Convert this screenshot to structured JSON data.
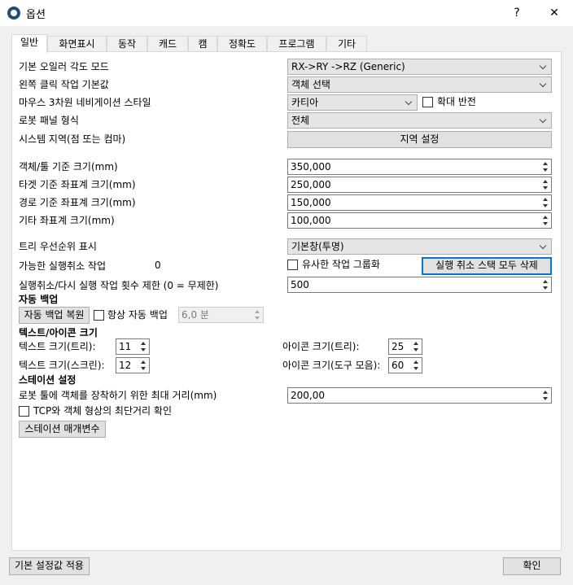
{
  "window": {
    "title": "옵션",
    "help": "?",
    "close": "✕"
  },
  "tabs": [
    "일반",
    "화면표시",
    "동작",
    "캐드",
    "캠",
    "정확도",
    "프로그램",
    "기타"
  ],
  "general": {
    "euler_label": "기본 오일러 각도 모드",
    "euler_value": "RX->RY ->RZ  (Generic)",
    "left_click_label": "왼쪽 클릭 작업 기본값",
    "left_click_value": "객체 선택",
    "mouse3d_label": "마우스 3차원 네비게이션 스타일",
    "mouse3d_value": "카티아",
    "zoom_invert_label": "확대 반전",
    "robot_panel_label": "로봇 패널 형식",
    "robot_panel_value": "전체",
    "region_label": "시스템 지역(점 또는 컴마)",
    "region_button": "지역 설정",
    "object_size_label": "객체/툴 기준 크기(mm)",
    "object_size_value": "350,000",
    "target_size_label": "타겟 기준 좌표계 크기(mm)",
    "target_size_value": "250,000",
    "path_size_label": "경로 기준 좌표계 크기(mm)",
    "path_size_value": "150,000",
    "other_size_label": "기타 좌표계 크기(mm)",
    "other_size_value": "100,000",
    "tree_priority_label": "트리 우선순위 표시",
    "tree_priority_value": "기본창(투명)",
    "undo_available_label": "가능한 실행취소 작업",
    "undo_available_value": "0",
    "group_similar_label": "유사한 작업 그룹화",
    "clear_undo_button": "실행 취소 스택 모두 삭제",
    "undo_limit_label": "실행취소/다시 실행 작업 횟수 제한 (0 = 무제한)",
    "undo_limit_value": "500"
  },
  "autobackup": {
    "heading": "자동 백업",
    "restore_button": "자동 백업 복원",
    "always_label": "항상 자동 백업",
    "interval_value": "6,0 분"
  },
  "textsize": {
    "heading": "텍스트/아이콘 크기",
    "text_tree_label": "텍스트 크기(트리):",
    "text_tree_value": "11",
    "text_screen_label": "텍스트 크기(스크린):",
    "text_screen_value": "12",
    "icon_tree_label": "아이콘 크기(트리):",
    "icon_tree_value": "25",
    "icon_toolbar_label": "아이콘 크기(도구 모음):",
    "icon_toolbar_value": "60"
  },
  "station": {
    "heading": "스테이션 설정",
    "max_dist_label": "로봇 툴에 객체를 장착하기 위한 최대 거리(mm)",
    "max_dist_value": "200,00",
    "tcp_check_label": "TCP와 객체 형상의 최단거리 확인",
    "params_button": "스테이션 매개변수"
  },
  "footer": {
    "defaults_button": "기본 설정값 적용",
    "ok_button": "확인"
  }
}
